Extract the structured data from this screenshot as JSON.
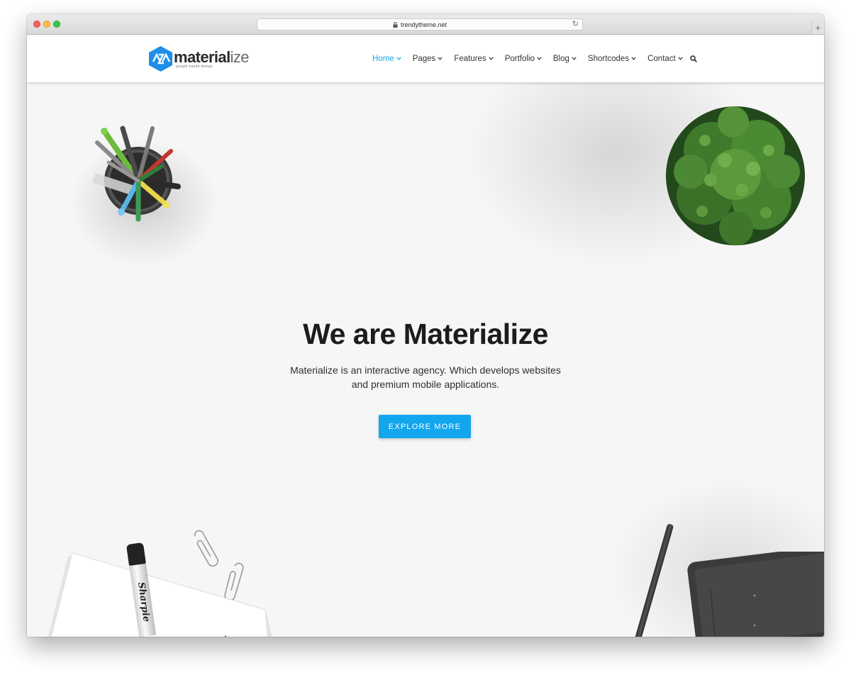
{
  "browser": {
    "url": "trendytheme.net"
  },
  "logo": {
    "name_bold": "material",
    "name_light": "ize",
    "tagline": "google based design"
  },
  "nav": {
    "items": [
      {
        "label": "Home"
      },
      {
        "label": "Pages"
      },
      {
        "label": "Features"
      },
      {
        "label": "Portfolio"
      },
      {
        "label": "Blog"
      },
      {
        "label": "Shortcodes"
      },
      {
        "label": "Contact"
      }
    ]
  },
  "hero": {
    "title": "We are Materialize",
    "subtitle_line1": "Materialize is an interactive agency. Which develops websites",
    "subtitle_line2": "and premium mobile applications.",
    "button_label": "EXPLORE MORE"
  },
  "decor": {
    "marker_text": "Sharpie"
  },
  "colors": {
    "accent": "#12a6ee",
    "nav_active": "#1fa6e8",
    "logo_blue": "#1e8ee8",
    "title": "#1c1c1c",
    "hero_bg": "#f6f6f6"
  }
}
